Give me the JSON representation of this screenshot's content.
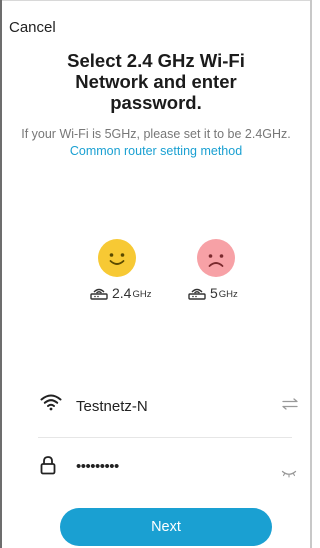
{
  "header": {
    "cancel_label": "Cancel"
  },
  "title": "Select 2.4 GHz Wi-Fi Network and enter password.",
  "subtitle": {
    "text": "If your Wi-Fi is 5GHz, please set it to be 2.4GHz.",
    "link_text": "Common router setting method"
  },
  "bands": [
    {
      "number": "2.4",
      "unit": "GHz",
      "face": "happy"
    },
    {
      "number": "5",
      "unit": "GHz",
      "face": "sad"
    }
  ],
  "form": {
    "ssid": "Testnetz-N",
    "password_masked": "•••••••••"
  },
  "next_label": "Next",
  "colors": {
    "accent": "#1aa0d2",
    "happy_face": "#f7c934",
    "sad_face": "#f7a1a6"
  },
  "icons": [
    "wifi-icon",
    "swap-icon",
    "lock-icon",
    "eye-closed-icon",
    "router-icon"
  ]
}
